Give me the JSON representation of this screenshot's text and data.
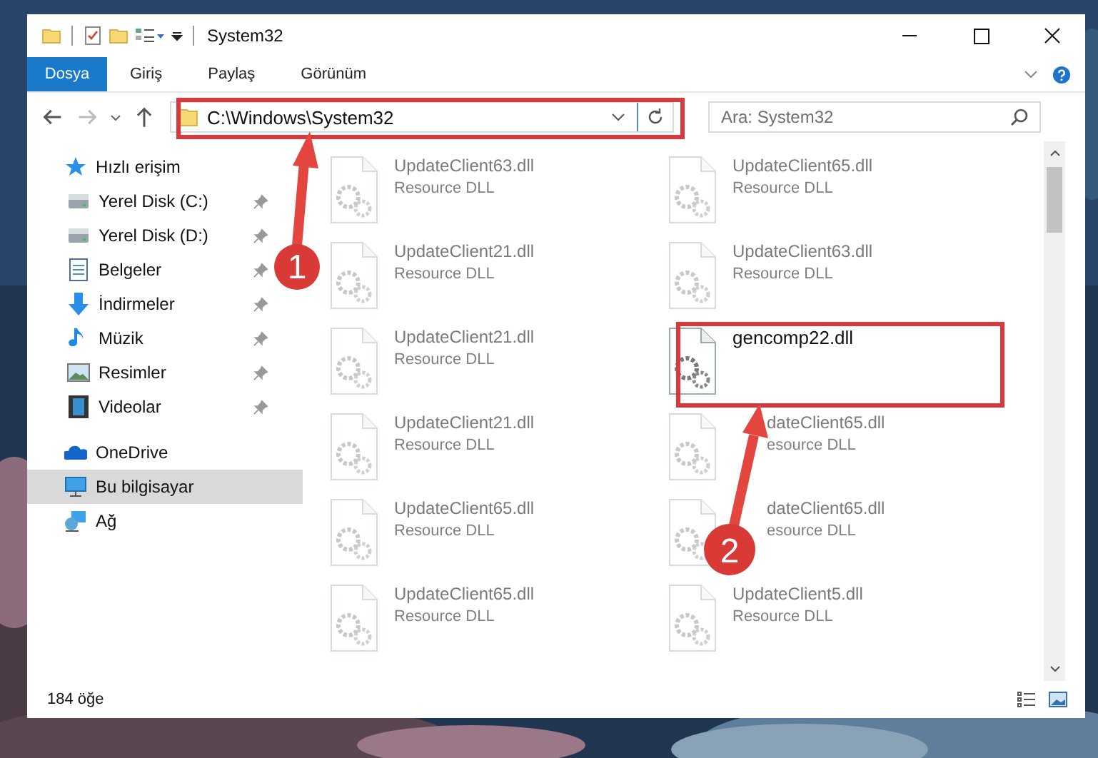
{
  "window": {
    "title": "System32"
  },
  "ribbon_tabs": [
    {
      "label": "Dosya",
      "selected": true
    },
    {
      "label": "Giriş",
      "selected": false
    },
    {
      "label": "Paylaş",
      "selected": false
    },
    {
      "label": "Görünüm",
      "selected": false
    }
  ],
  "address": {
    "path": "C:\\Windows\\System32"
  },
  "search": {
    "placeholder": "Ara: System32"
  },
  "sidebar": {
    "items": [
      {
        "label": "Hızlı erişim",
        "kind": "star",
        "selected": false,
        "children": [
          {
            "label": "Yerel Disk (C:)",
            "kind": "drive",
            "selected": false,
            "pinned": true
          },
          {
            "label": "Yerel Disk (D:)",
            "kind": "drive",
            "selected": false,
            "pinned": true
          },
          {
            "label": "Belgeler",
            "kind": "documents",
            "selected": false,
            "pinned": true
          },
          {
            "label": "İndirmeler",
            "kind": "download",
            "selected": false,
            "pinned": true
          },
          {
            "label": "Müzik",
            "kind": "music",
            "selected": false,
            "pinned": true
          },
          {
            "label": "Resimler",
            "kind": "pictures",
            "selected": false,
            "pinned": true
          },
          {
            "label": "Videolar",
            "kind": "videos",
            "selected": false,
            "pinned": true
          }
        ]
      },
      {
        "label": "OneDrive",
        "kind": "cloud",
        "selected": false
      },
      {
        "label": "Bu bilgisayar",
        "kind": "computer",
        "selected": true
      },
      {
        "label": "Ağ",
        "kind": "network",
        "selected": false
      }
    ]
  },
  "files": [
    {
      "name": "UpdateClient63.dll",
      "type": "Resource DLL",
      "dimmed": true,
      "covered": false
    },
    {
      "name": "UpdateClient65.dll",
      "type": "Resource DLL",
      "dimmed": true,
      "covered": false
    },
    {
      "name": "UpdateClient21.dll",
      "type": "Resource DLL",
      "dimmed": true,
      "covered": false
    },
    {
      "name": "UpdateClient63.dll",
      "type": "Resource DLL",
      "dimmed": true,
      "covered": false
    },
    {
      "name": "UpdateClient21.dll",
      "type": "Resource DLL",
      "dimmed": true,
      "covered": false
    },
    {
      "name": "gencomp22.dll",
      "dimmed": false,
      "covered": false
    },
    {
      "name": "UpdateClient21.dll",
      "type": "Resource DLL",
      "dimmed": true,
      "covered": false
    },
    {
      "name": "dateClient65.dll",
      "type": "esource DLL",
      "dimmed": true,
      "covered": true
    },
    {
      "name": "UpdateClient65.dll",
      "type": "Resource DLL",
      "dimmed": true,
      "covered": false
    },
    {
      "name": "dateClient65.dll",
      "type": "esource DLL",
      "dimmed": true,
      "covered": true
    },
    {
      "name": "UpdateClient65.dll",
      "type": "Resource DLL",
      "dimmed": true,
      "covered": false
    },
    {
      "name": "UpdateClient5.dll",
      "type": "Resource DLL",
      "dimmed": true,
      "covered": false
    }
  ],
  "status_bar": {
    "count": "184 öğe"
  },
  "annotations": [
    {
      "number": "1"
    },
    {
      "number": "2"
    }
  ]
}
